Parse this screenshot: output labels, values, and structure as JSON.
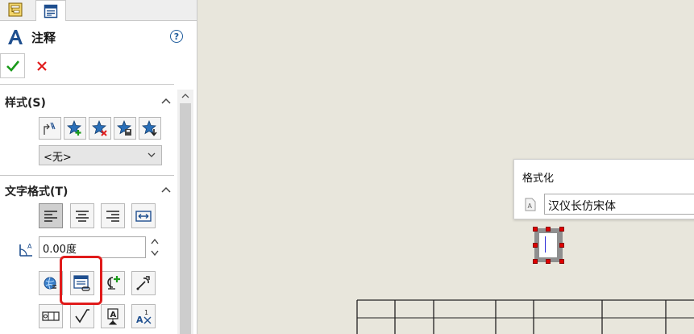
{
  "property_manager": {
    "title": "注释",
    "tabs": [
      {
        "icon": "feature-manager-tree-icon"
      },
      {
        "icon": "property-manager-icon"
      }
    ],
    "help_label": "?"
  },
  "sections": {
    "style": {
      "title": "样式(S)",
      "buttons": [
        "apply-style-icon",
        "add-style-icon",
        "delete-style-icon",
        "save-style-icon",
        "load-style-icon"
      ],
      "dropdown_value": "<无>"
    },
    "text_format": {
      "title": "文字格式(T)",
      "align_buttons": [
        "align-left-icon",
        "align-center-icon",
        "align-right-icon",
        "fit-text-icon"
      ],
      "angle_value": "0.00度"
    }
  },
  "format_popup": {
    "title": "格式化",
    "font_value": "汉仪长仿宋体"
  },
  "colors": {
    "canvas": "#e8e6dc",
    "highlight": "#e01b1b",
    "ok_green": "#1a9a1a",
    "cancel_red": "#e01b1b"
  }
}
